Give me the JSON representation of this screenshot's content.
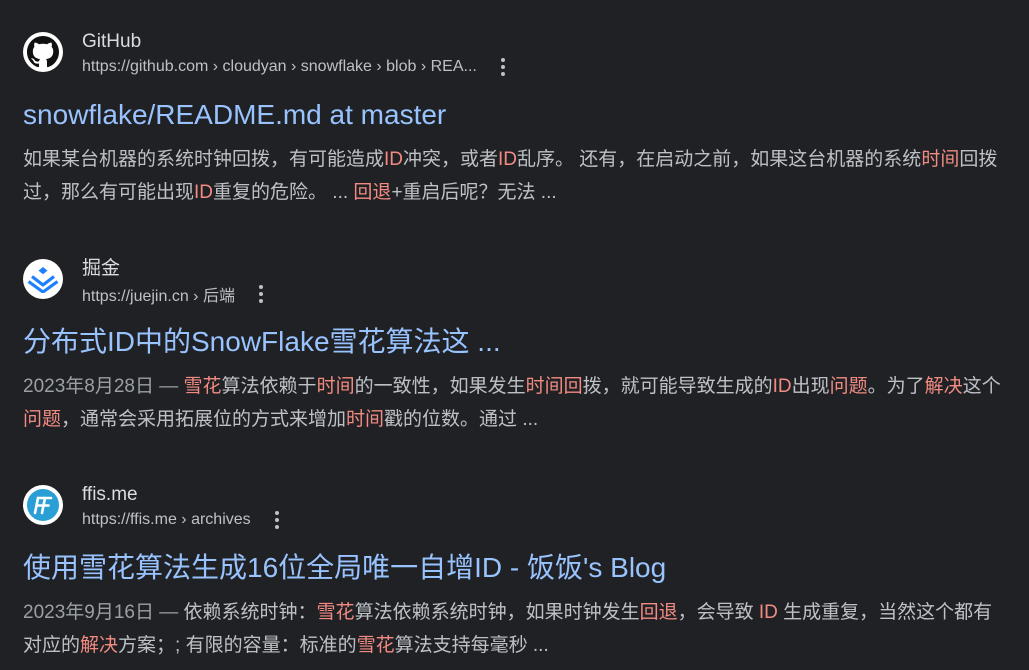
{
  "results": [
    {
      "site_name": "GitHub",
      "url": "https://github.com › cloudyan › snowflake › blob › REA...",
      "title": "snowflake/README.md at master",
      "date": "",
      "snippet": [
        {
          "t": "如果某台机器的系统时钟回拨，有可能造成",
          "h": false
        },
        {
          "t": "ID",
          "h": true
        },
        {
          "t": "冲突，或者",
          "h": false
        },
        {
          "t": "ID",
          "h": true
        },
        {
          "t": "乱序。 还有，在启动之前，如果这台机器的系统",
          "h": false
        },
        {
          "t": "时间",
          "h": true
        },
        {
          "t": "回拨过，那么有可能出现",
          "h": false
        },
        {
          "t": "ID",
          "h": true
        },
        {
          "t": "重复的危险。 ... ",
          "h": false
        },
        {
          "t": "回退",
          "h": true
        },
        {
          "t": "+重启后呢？无法 ...",
          "h": false
        }
      ],
      "icon": "github-icon"
    },
    {
      "site_name": "掘金",
      "url": "https://juejin.cn › 后端",
      "title": "分布式ID中的SnowFlake雪花算法这 ...",
      "date": "2023年8月28日 — ",
      "snippet": [
        {
          "t": "雪花",
          "h": true
        },
        {
          "t": "算法依赖于",
          "h": false
        },
        {
          "t": "时间",
          "h": true
        },
        {
          "t": "的一致性，如果发生",
          "h": false
        },
        {
          "t": "时间回",
          "h": true
        },
        {
          "t": "拨，就可能导致生成的",
          "h": false
        },
        {
          "t": "ID",
          "h": true
        },
        {
          "t": "出现",
          "h": false
        },
        {
          "t": "问题",
          "h": true
        },
        {
          "t": "。为了",
          "h": false
        },
        {
          "t": "解决",
          "h": true
        },
        {
          "t": "这个",
          "h": false
        },
        {
          "t": "问题",
          "h": true
        },
        {
          "t": "，通常会采用拓展位的方式来增加",
          "h": false
        },
        {
          "t": "时间",
          "h": true
        },
        {
          "t": "戳的位数。通过 ...",
          "h": false
        }
      ],
      "icon": "juejin-icon"
    },
    {
      "site_name": "ffis.me",
      "url": "https://ffis.me › archives",
      "title": "使用雪花算法生成16位全局唯一自增ID - 饭饭's Blog",
      "date": "2023年9月16日 — ",
      "snippet": [
        {
          "t": "依赖系统时钟：",
          "h": false
        },
        {
          "t": "雪花",
          "h": true
        },
        {
          "t": "算法依赖系统时钟，如果时钟发生",
          "h": false
        },
        {
          "t": "回退",
          "h": true
        },
        {
          "t": "，会导致 ",
          "h": false
        },
        {
          "t": "ID",
          "h": true
        },
        {
          "t": " 生成重复，当然这个都有对应的",
          "h": false
        },
        {
          "t": "解决",
          "h": true
        },
        {
          "t": "方案；; 有限的容量：标准的",
          "h": false
        },
        {
          "t": "雪花",
          "h": true
        },
        {
          "t": "算法支持每毫秒 ...",
          "h": false
        }
      ],
      "icon": "ffis-icon"
    }
  ],
  "colors": {
    "background": "#202124",
    "title_link": "#99c3ff",
    "highlight": "#f28b82",
    "snippet_text": "#bdc1c6"
  }
}
